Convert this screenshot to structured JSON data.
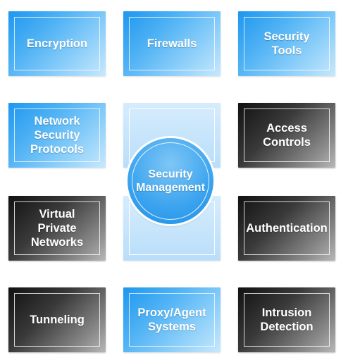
{
  "diagram": {
    "center": {
      "label": "Security\nManagement"
    },
    "tiles": [
      {
        "key": "encryption",
        "label": "Encryption",
        "style": "blue"
      },
      {
        "key": "firewalls",
        "label": "Firewalls",
        "style": "blue"
      },
      {
        "key": "security-tools",
        "label": "Security\nTools",
        "style": "blue"
      },
      {
        "key": "network-security-protocols",
        "label": "Network\nSecurity\nProtocols",
        "style": "blue"
      },
      {
        "key": "access-controls",
        "label": "Access\nControls",
        "style": "dark"
      },
      {
        "key": "virtual-private-networks",
        "label": "Virtual\nPrivate\nNetworks",
        "style": "dark"
      },
      {
        "key": "authentication",
        "label": "Authentication",
        "style": "dark"
      },
      {
        "key": "tunneling",
        "label": "Tunneling",
        "style": "dark"
      },
      {
        "key": "proxy-agent-systems",
        "label": "Proxy/Agent\nSystems",
        "style": "blue"
      },
      {
        "key": "intrusion-detection",
        "label": "Intrusion\nDetection",
        "style": "dark"
      }
    ]
  }
}
